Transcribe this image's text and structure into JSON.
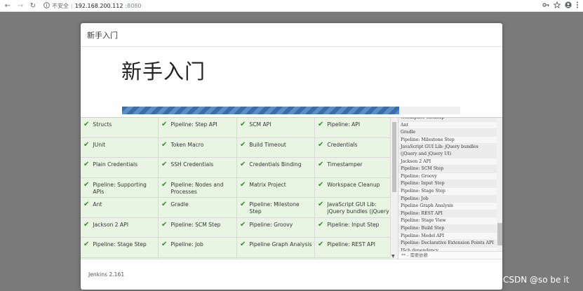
{
  "browser": {
    "back_icon": "←",
    "forward_icon": "→",
    "reload_icon": "↻",
    "security_label": "不安全",
    "url_host": "192.168.200.112",
    "url_port": ":8080"
  },
  "dialog": {
    "header_title": "新手入门",
    "big_title": "新手入门",
    "progress": 0.82,
    "footer_text": "Jenkins 2.161"
  },
  "plugins": [
    "Structs",
    "Pipeline: Step API",
    "SCM API",
    "Pipeline: API",
    "JUnit",
    "Token Macro",
    "Build Timeout",
    "Credentials",
    "Plain Credentials",
    "SSH Credentials",
    "Credentials Binding",
    "Timestamper",
    "Pipeline: Supporting APIs",
    "Pipeline: Nodes and Processes",
    "Matrix Project",
    "Workspace Cleanup",
    "Ant",
    "Gradle",
    "Pipeline: Milestone Step",
    "JavaScript GUI Lib: jQuery bundles (jQuery",
    "Jackson 2 API",
    "Pipeline: SCM Step",
    "Pipeline: Groovy",
    "Pipeline: Input Step",
    "Pipeline: Stage Step",
    "Pipeline: Job",
    "Pipeline Graph Analysis",
    "Pipeline: REST API",
    "Pipeline: Stage View",
    "Pipeline: Build Step",
    "Pipeline: Model API",
    "Pipeline: Declarative"
  ],
  "log": [
    "Workspace Cleanup",
    "Ant",
    "Gradle",
    "Pipeline: Milestone Step",
    "JavaScript GUI Lib: jQuery bundles (jQuery and jQuery UI)",
    "Jackson 2 API",
    "Pipeline: SCM Step",
    "Pipeline: Groovy",
    "Pipeline: Input Step",
    "Pipeline: Stage Step",
    "Pipeline: Job",
    "Pipeline Graph Analysis",
    "Pipeline: REST API",
    "Pipeline: Stage View",
    "Pipeline: Build Step",
    "Pipeline: Model API",
    "Pipeline: Declarative Extension Points API",
    "JSch dependency"
  ],
  "log_footer": "** - 需要依赖",
  "watermark": "CSDN @so be it"
}
